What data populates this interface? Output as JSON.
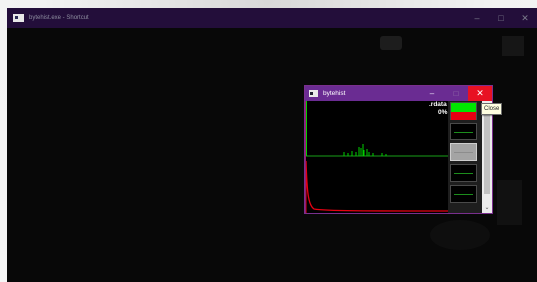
{
  "outer_window": {
    "title": "bytehist.exe - Shortcut",
    "controls": {
      "minimize": "–",
      "maximize": "□",
      "close": "✕"
    },
    "icon": "app-window-icon"
  },
  "inner_window": {
    "title": "bytehist",
    "controls": {
      "minimize": "–",
      "maximize": "□",
      "close": "✕"
    },
    "icon": "app-window-icon",
    "section_label": ".rdata",
    "percent_label": "0%",
    "tooltip": "Close",
    "scroll_down_icon": "⌄"
  },
  "colors": {
    "outer_titlebar": "#230e3a",
    "inner_titlebar": "#6a2c92",
    "close_red": "#e81123",
    "hist_green": "#00e600",
    "entropy_red": "#e60012"
  }
}
